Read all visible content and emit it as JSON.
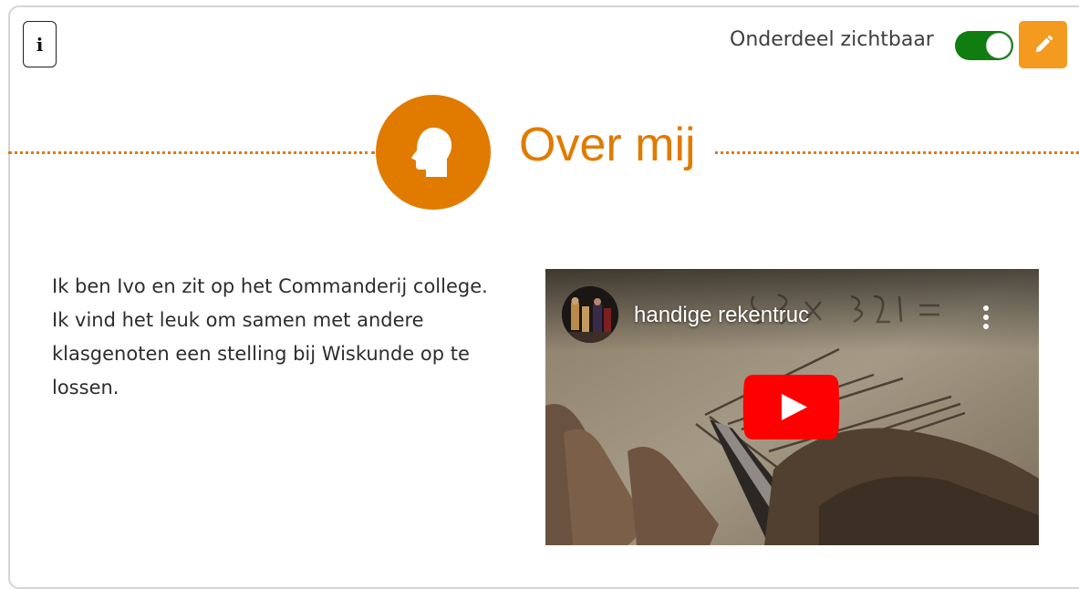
{
  "header": {
    "info_label": "i",
    "visibility_label": "Onderdeel zichtbaar",
    "visibility_on": true,
    "info_icon": "info-icon",
    "edit_icon": "pencil-icon"
  },
  "section": {
    "title": "Over mij",
    "icon": "head-silhouette-icon",
    "accent_color": "#e07b00"
  },
  "intro": {
    "text": "Ik ben Ivo en zit op het Commanderij college. Ik vind het leuk om samen met andere klasgenoten een stelling bij Wiskunde op te lossen."
  },
  "video": {
    "title": "handige rekentruc",
    "play_icon": "youtube-play-icon",
    "menu_icon": "more-vertical-icon",
    "brand_color": "#ff0000"
  },
  "colors": {
    "toggle_on": "#0f7d0f",
    "edit_button": "#f39a1f"
  }
}
